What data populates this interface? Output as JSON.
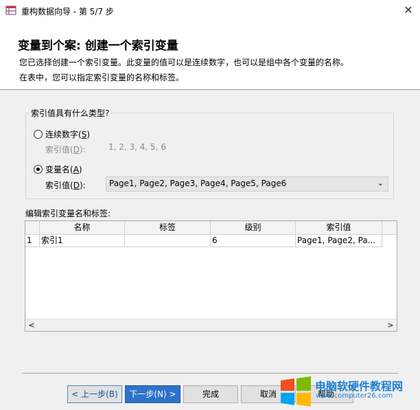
{
  "window": {
    "title": "重构数据向导 - 第 5/7 步"
  },
  "header": {
    "heading": "变量到个案: 创建一个索引变量",
    "desc1": "您已选择创建一个索引变量。此变量的值可以是连续数字，也可以是组中各个变量的名称。",
    "desc2": "在表中，您可以指定索引变量的名称和标签。"
  },
  "group": {
    "legend": "索引值具有什么类型?",
    "option1": {
      "label_pre": "连续数字(",
      "label_key": "S",
      "label_post": ")",
      "selected": false
    },
    "seq_values_label_pre": "索引值(",
    "seq_values_label_key": "D",
    "seq_values_label_post": "):",
    "seq_values": "1, 2, 3, 4, 5, 6",
    "option2": {
      "label_pre": "变量名(",
      "label_key": "A",
      "label_post": ")",
      "selected": true
    },
    "var_values_label_pre": "索引值(",
    "var_values_label_key": "D",
    "var_values_label_post": "):",
    "var_values": "Page1, Page2, Page3, Page4, Page5, Page6"
  },
  "grid": {
    "label": "编辑索引变量名和标签:",
    "columns": [
      "名称",
      "标签",
      "级别",
      "索引值"
    ],
    "rows": [
      {
        "num": "1",
        "name": "索引1",
        "label": "",
        "level": "6",
        "values": "Page1, Page2, Pa..."
      }
    ]
  },
  "buttons": {
    "back": "< 上一步(B)",
    "next": "下一步(N) >",
    "finish": "完成",
    "cancel": "取消",
    "help": "帮助"
  },
  "watermark": {
    "title": "电脑软硬件教程网",
    "url": "www.computer26.com"
  },
  "colors": {
    "accent": "#2e73c9",
    "watermark": "#1e7fd6"
  }
}
